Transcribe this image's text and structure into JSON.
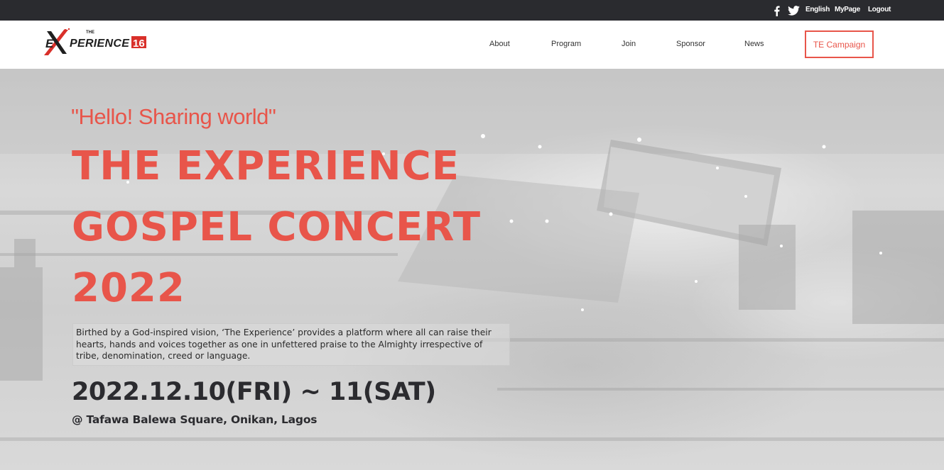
{
  "topbar": {
    "facebook_icon": "facebook-icon",
    "twitter_icon": "twitter-icon",
    "language": "English",
    "my_page": "MyPage",
    "logout": "Logout"
  },
  "header": {
    "logo": {
      "prefix": "THE",
      "first_letters": "E",
      "rest": "PERIENCE",
      "x": "X",
      "number": "16"
    },
    "nav": {
      "about": "About",
      "program": "Program",
      "join": "Join",
      "sponsor": "Sponsor",
      "news": "News",
      "campaign": "TE Campaign"
    }
  },
  "hero": {
    "tagline": "\"Hello! Sharing world\"",
    "title_line1": "THE EXPERIENCE",
    "title_line2": "GOSPEL CONCERT",
    "title_line3": "2022",
    "description": "Birthed by a God-inspired vision, ‘The Experience’ provides a platform where all can raise their hearts, hands and voices together as one in unfettered praise to the Almighty irrespective of tribe, denomination, creed or language.",
    "date": "2022.12.10(FRI) ~ 11(SAT)",
    "venue": "@ Tafawa Balewa Square, Onikan, Lagos"
  },
  "colors": {
    "accent": "#e8554a",
    "topbar": "#2a2b2f",
    "dark_text": "#2b2b2f"
  }
}
